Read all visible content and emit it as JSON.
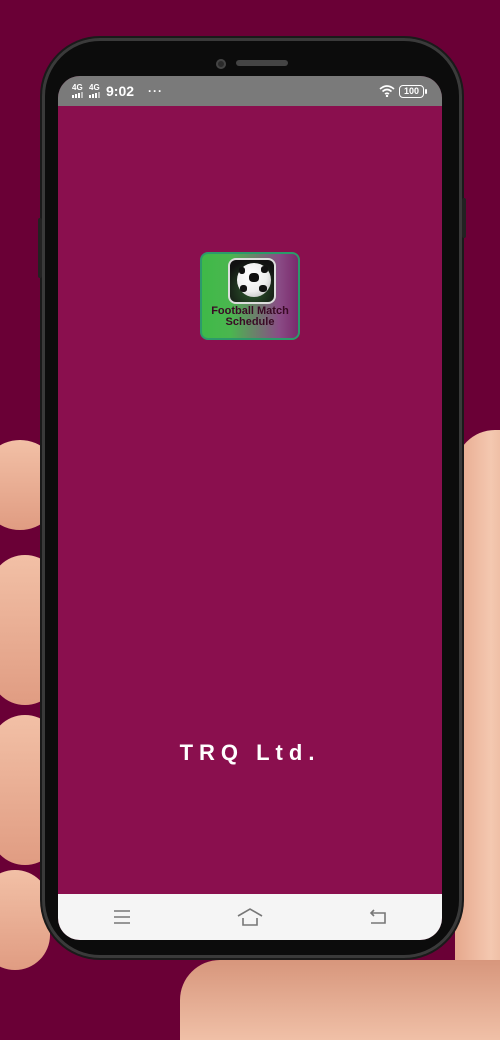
{
  "status_bar": {
    "signal_1": "4G",
    "signal_2": "4G",
    "time": "9:02",
    "overflow": "···",
    "wifi_icon": "wifi-icon",
    "battery": "100"
  },
  "splash": {
    "app_icon": {
      "title_line_1": "Football Match",
      "title_line_2": "Schedule",
      "graphic": "soccer-ball-in-net"
    },
    "brand": "TRQ Ltd."
  },
  "nav_bar": {
    "items": [
      {
        "name": "menu",
        "icon": "menu-icon"
      },
      {
        "name": "home",
        "icon": "home-icon"
      },
      {
        "name": "back",
        "icon": "back-icon"
      }
    ]
  },
  "colors": {
    "background": "#6a0036",
    "screen": "#8a0f4e",
    "status_bar": "#7a7a7a",
    "nav_bar": "#f5f5f5",
    "icon_green": "#3fb948",
    "icon_purple": "#7b2a6c"
  }
}
